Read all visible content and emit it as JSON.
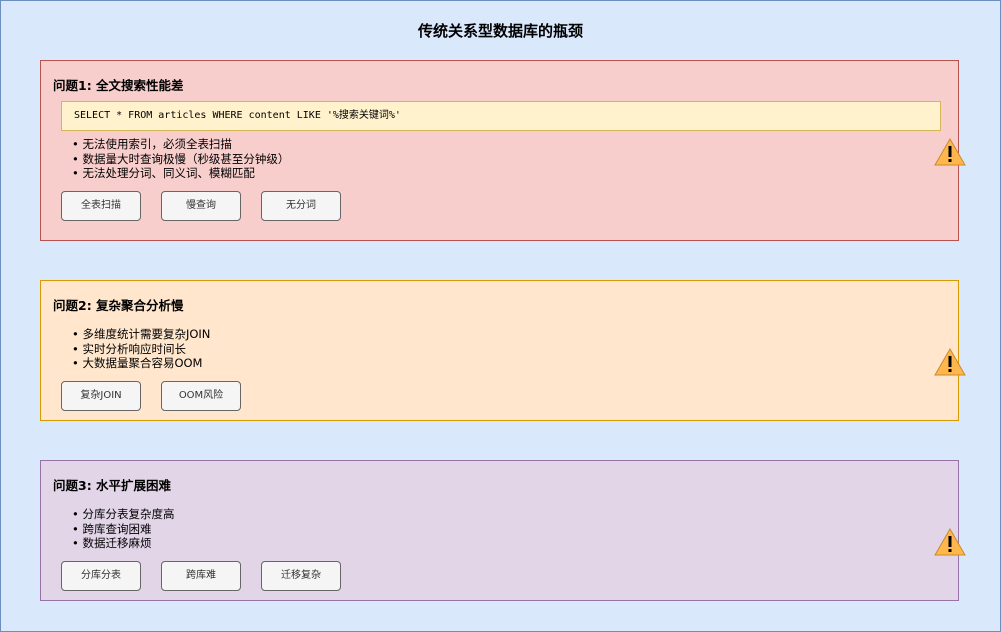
{
  "title": "传统关系型数据库的瓶颈",
  "problems": [
    {
      "heading": "问题1: 全文搜索性能差",
      "code": "SELECT * FROM articles WHERE content LIKE '%搜索关键词%'",
      "bullets": [
        "• 无法使用索引，必须全表扫描",
        "• 数据量大时查询极慢（秒级甚至分钟级）",
        "• 无法处理分词、同义词、模糊匹配"
      ],
      "tags": [
        "全表扫描",
        "慢查询",
        "无分词"
      ]
    },
    {
      "heading": "问题2: 复杂聚合分析慢",
      "bullets": [
        "• 多维度统计需要复杂JOIN",
        "• 实时分析响应时间长",
        "• 大数据量聚合容易OOM"
      ],
      "tags": [
        "复杂JOIN",
        "OOM风险"
      ]
    },
    {
      "heading": "问题3: 水平扩展困难",
      "bullets": [
        "• 分库分表复杂度高",
        "• 跨库查询困难",
        "• 数据迁移麻烦"
      ],
      "tags": [
        "分库分表",
        "跨库难",
        "迁移复杂"
      ]
    }
  ],
  "icons": {
    "warning": "warning-icon"
  },
  "colors": {
    "background": "#dae8fc",
    "problem1_fill": "#f8cecc",
    "problem2_fill": "#ffe6cc",
    "problem3_fill": "#e1d5e7",
    "code_fill": "#fff2cc",
    "tag_fill": "#f5f5f5",
    "warning_fill": "#ffb74d"
  }
}
